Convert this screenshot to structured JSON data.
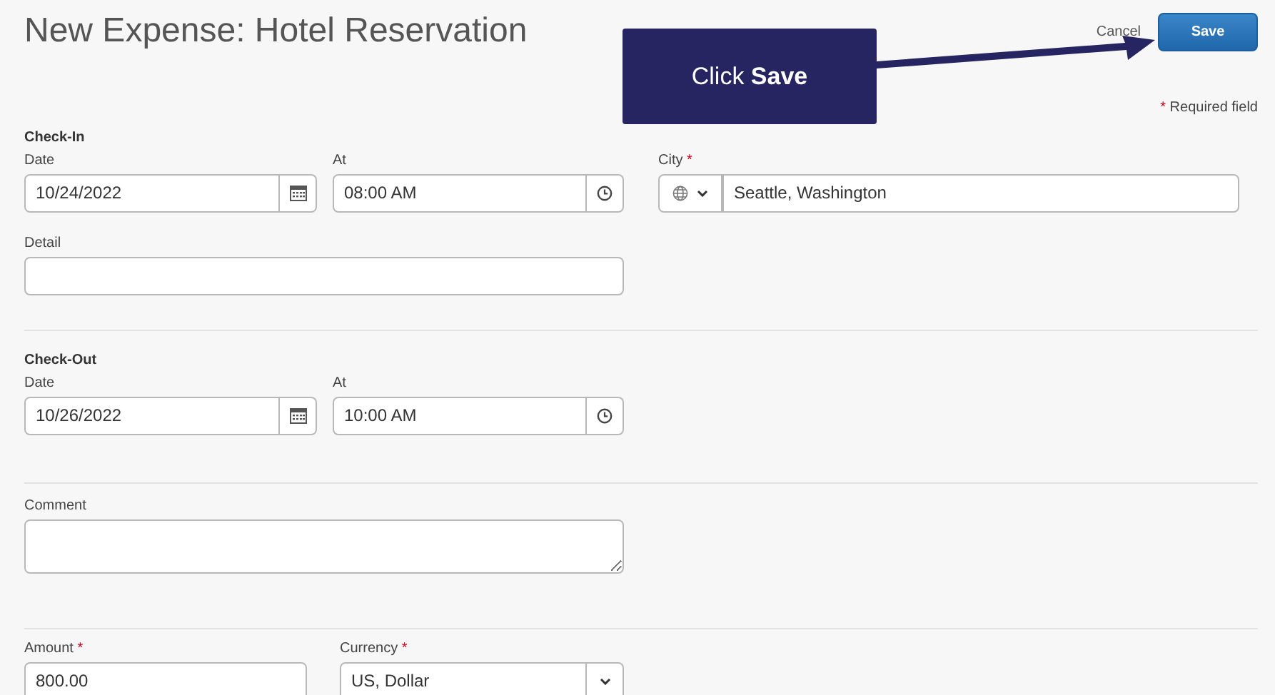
{
  "header": {
    "title": "New Expense: Hotel Reservation",
    "cancel": "Cancel",
    "save": "Save"
  },
  "callout": {
    "text": "Click **Save**"
  },
  "required_note": {
    "mark": "*",
    "text": "Required field"
  },
  "sections": [
    {
      "heading": "Check-In",
      "fields": [
        {
          "kind": "date",
          "label": "Date",
          "value": "10/24/2022"
        },
        {
          "kind": "time",
          "label": "At",
          "value": "08:00 AM"
        },
        {
          "kind": "city",
          "label": "City",
          "required_mark": "*",
          "value": "Seattle, Washington"
        },
        {
          "kind": "text",
          "label": "Detail"
        }
      ]
    },
    {
      "heading": "Check-Out",
      "fields": [
        {
          "kind": "date",
          "label": "Date",
          "value": "10/26/2022"
        },
        {
          "kind": "time",
          "label": "At",
          "value": "10:00 AM"
        }
      ]
    },
    {
      "fields": [
        {
          "kind": "textarea",
          "label": "Comment"
        }
      ]
    },
    {
      "fields": [
        {
          "kind": "amount",
          "label": "Amount",
          "required_mark": "*",
          "value": "800.00"
        },
        {
          "kind": "select",
          "label": "Currency",
          "required_mark": "*",
          "value": "US, Dollar"
        }
      ]
    }
  ]
}
